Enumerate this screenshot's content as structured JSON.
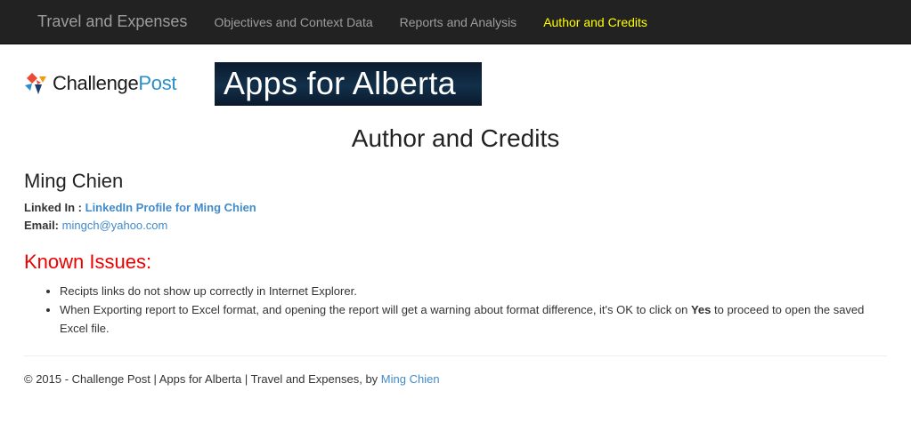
{
  "navbar": {
    "brand": "Travel and Expenses",
    "items": [
      {
        "label": "Objectives and Context Data",
        "active": false
      },
      {
        "label": "Reports and Analysis",
        "active": false
      },
      {
        "label": "Author and Credits",
        "active": true
      }
    ],
    "active_color": "#ffff00"
  },
  "logos": {
    "challengepost_word1": "Challenge",
    "challengepost_word2": "Post",
    "apps_for_alberta": "Apps for Alberta"
  },
  "page": {
    "title": "Author and Credits"
  },
  "author": {
    "name": "Ming Chien",
    "linkedin_label": "Linked In :",
    "linkedin_link_text": "LinkedIn Profile for Ming Chien",
    "email_label": "Email:",
    "email": "mingch@yahoo.com"
  },
  "issues": {
    "title": "Known Issues:",
    "title_color": "#ee0000",
    "item1": "Recipts links do not show up correctly in Internet Explorer.",
    "item2_before": "When Exporting report to Excel format, and opening the report will get a warning about format difference, it's OK to click on ",
    "item2_bold": "Yes",
    "item2_after": " to proceed to open the saved Excel file."
  },
  "footer": {
    "text": "© 2015 - Challenge Post | Apps for Alberta | Travel and Expenses, by ",
    "author_link": "Ming Chien"
  }
}
